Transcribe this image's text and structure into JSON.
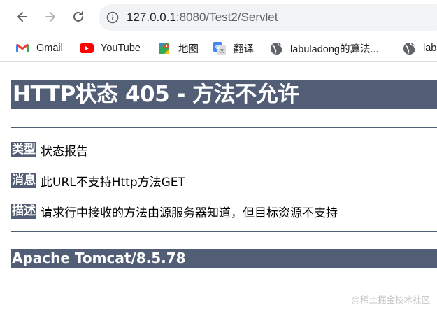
{
  "browser": {
    "url_host": "127.0.0.1",
    "url_rest": ":8080/Test2/Servlet",
    "bookmarks": [
      {
        "label": "Gmail",
        "icon": "gmail-icon"
      },
      {
        "label": "YouTube",
        "icon": "youtube-icon"
      },
      {
        "label": "地图",
        "icon": "maps-icon"
      },
      {
        "label": "翻译",
        "icon": "translate-icon"
      },
      {
        "label": "labuladong的算法...",
        "icon": "globe-icon"
      },
      {
        "label": "lab",
        "icon": "globe-icon"
      }
    ]
  },
  "page": {
    "title": "HTTP状态 405 - 方法不允许",
    "type_label": "类型",
    "type_value": "状态报告",
    "message_label": "消息",
    "message_value": "此URL不支持Http方法GET",
    "description_label": "描述",
    "description_value": "请求行中接收的方法由源服务器知道，但目标资源不支持",
    "footer": "Apache Tomcat/8.5.78",
    "watermark": "@稀土掘金技术社区"
  },
  "colors": {
    "tomcat_header": "#525d76",
    "omnibox": "#f1f3f4"
  }
}
